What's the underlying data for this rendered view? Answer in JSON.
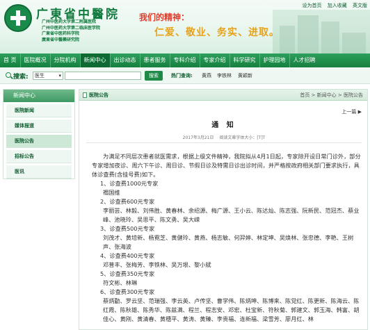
{
  "header": {
    "hospital_name": "广東省中醫院",
    "affiliations": [
      "广州中医药大学第二附属医院",
      "广州中医药大学第二临床医学院",
      "广東省中医药科学院",
      "廣東省中醫藥研究院"
    ],
    "spirit_title": "我们的精神：",
    "spirit_motto": "仁爱、敬业、务实、进取。",
    "top_links": [
      "设为首页",
      "加入收藏",
      "英文版"
    ],
    "brand_color": "#117a3e"
  },
  "nav": {
    "items": [
      "首 页",
      "医院概况",
      "分院机构",
      "新闻中心",
      "出诊动态",
      "患者服务",
      "专科介绍",
      "专家介绍",
      "科学研究",
      "护理园地",
      "人才招聘"
    ],
    "active_index": 3
  },
  "search": {
    "label": "搜索:",
    "select_value": "医生",
    "input_value": "",
    "button_label": "搜索",
    "hot_label": "热门查询:",
    "hot_links": [
      "黄燕",
      "李铁林",
      "黄颖新"
    ]
  },
  "sidebar": {
    "title": "新闻中心",
    "items": [
      "医院新闻",
      "媒体报道",
      "医院公告",
      "招标公告",
      "医讯"
    ],
    "active_index": 2
  },
  "main": {
    "section_title": "医院公告",
    "breadcrumb": "首页 > 新闻中心 > 医院公告",
    "pager": "上一篇 ▶",
    "article_title": "通 知",
    "date": "2017年3月21日",
    "meta_views": "阅读文章字体大小：[T]T",
    "paragraph": "为满足不同层次患者就医需求，根据上级文件精神，我院拟从4月1日起，专家除开设日常门诊外，部分专家增加夜诊、周六下午诊、周日诊、节假日诊及特需日诊出诊时间，并严格按政府相关部门要求执行，具体诊查费(含挂号费)如下。",
    "fee_list": [
      {
        "level": "1、诊查费1000元专家",
        "names": "禤国维"
      },
      {
        "level": "2、诊查费600元专家",
        "names": "李丽芸、林毅、刘伟胜、黄春林、余绍源、梅广源、王小云、陈达灿、陈志强、阮新民、范冠杰、蔡业峰、池晓玲、吴思平、陈文勇、吴大嵘"
      },
      {
        "level": "3、诊查费500元专家",
        "names": "刘茂才、黄培新、杨霓芝、黄健玲、黄燕、杨志敏、何羿婷、林定坤、吴焕林、张忠德、李艳、王树声、张海波"
      },
      {
        "level": "4、诊查费400元专家",
        "names": "邓普丰、张梅芳、李铁林、吴万垠、黎小斌"
      },
      {
        "level": "5、诊查费350元专家",
        "names": "符文彬、林琳"
      },
      {
        "level": "6、诊查费300元专家",
        "names": "蔡炳勤、罗云坚、范瑞强、李云英、卢传坚、曹学伟、陈炳坤、陈博来、陈党红、陈更新、陈海云、陈红霞、陈秋雄、陈秀华、陈兹满、程兰、程志安、邓宏、杜宝新、符秋菊、郭建文、郭玉海、韩富、胡佳心、黄刚、黄清春、黄穗平、黄涛、黄臻、李贵福、连新福、梁雪芳、廖月红、林"
      }
    ]
  }
}
